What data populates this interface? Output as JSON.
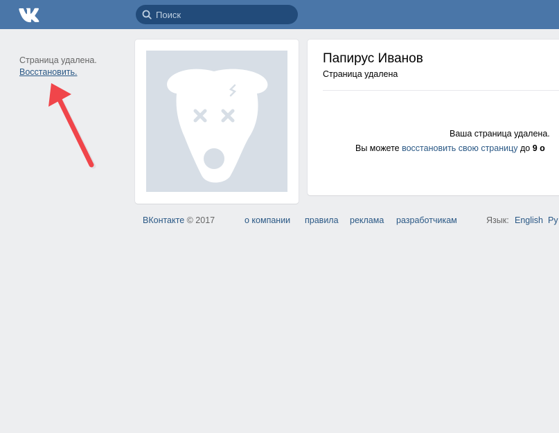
{
  "header": {
    "search_placeholder": "Поиск",
    "logo_icon": "vk-logo-icon",
    "colors": {
      "topbar": "#4a76a8",
      "search_bg": "#224b7a"
    }
  },
  "left_notice": {
    "message": "Страница удалена.",
    "restore_link": "Восстановить."
  },
  "profile": {
    "name": "Папирус Иванов",
    "status": "Страница удалена",
    "deleted_message": "Ваша страница удалена.",
    "restore_prefix": "Вы можете ",
    "restore_link": "восстановить свою страницу",
    "restore_middle": " до ",
    "restore_date": "9 о",
    "avatar_icon": "deleted-dog-icon"
  },
  "footer": {
    "copyright_brand": "ВКонтакте",
    "copyright_year": " © 2017",
    "links": [
      "о компании",
      "правила",
      "реклама",
      "разработчикам"
    ],
    "language_label": "Язык:",
    "languages": [
      "English",
      "Ру"
    ]
  },
  "annotation": {
    "arrow_color": "#f0454a"
  }
}
